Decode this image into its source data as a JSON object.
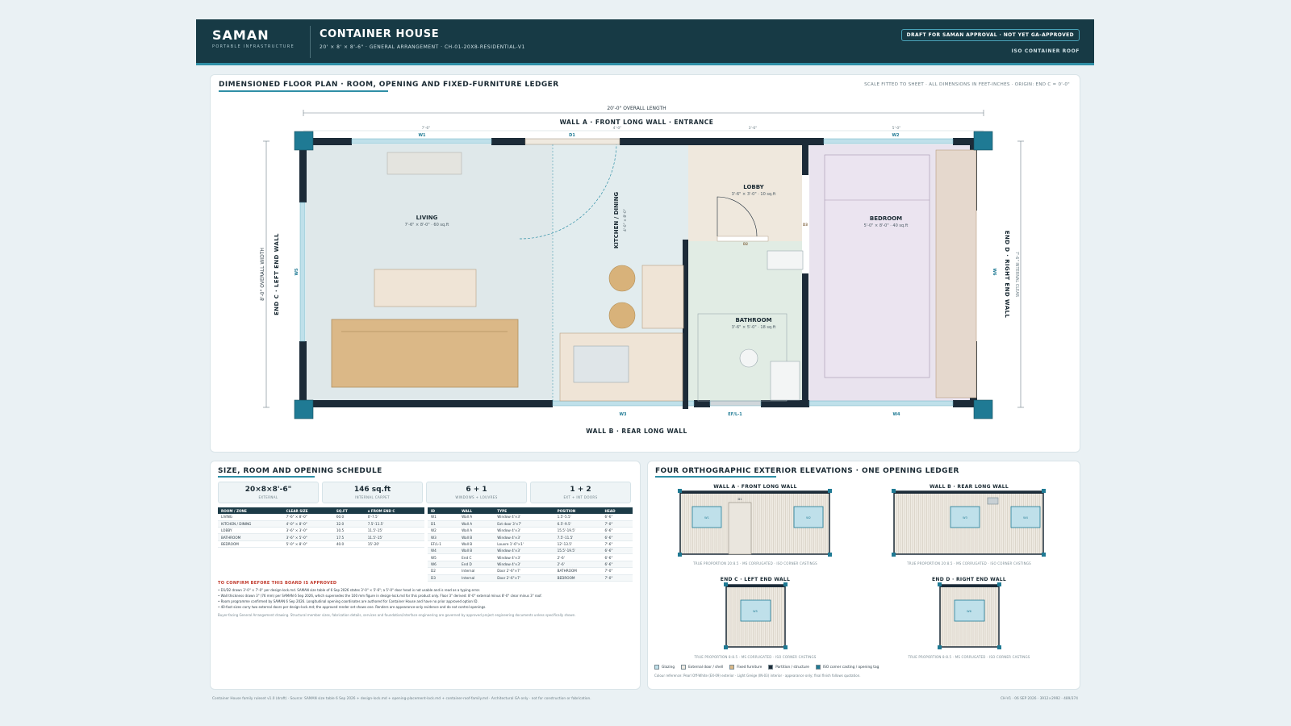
{
  "header": {
    "brand": "SAMAN",
    "brand_sub": "PORTABLE INFRASTRUCTURE",
    "title": "CONTAINER HOUSE",
    "subtitle": "20' × 8' × 8'-6\" · GENERAL ARRANGEMENT · CH-01-20X8-RESIDENTIAL-V1",
    "badge": "DRAFT FOR SAMAN APPROVAL · NOT YET GA-APPROVED",
    "roof": "ISO CONTAINER ROOF"
  },
  "plan": {
    "title": "DIMENSIONED FLOOR PLAN · ROOM, OPENING AND FIXED-FURNITURE LEDGER",
    "scale_note": "SCALE FITTED TO SHEET · ALL DIMENSIONS IN FEET-INCHES · ORIGIN: END C = 0'-0\"",
    "overall_length": "20'-0\" OVERALL LENGTH",
    "overall_width": "8'-0\" OVERALL WIDTH",
    "internal_clear": "7'-6\" INTERNAL CLEAR",
    "wall_a": "WALL A · FRONT LONG WALL · ENTRANCE",
    "wall_b": "WALL B · REAR LONG WALL",
    "wall_c": "END C · LEFT END WALL",
    "wall_d": "END D · RIGHT END WALL",
    "top_dims": [
      "7'-6\"",
      "4'-0\"",
      "3'-6\"",
      "5'-0\""
    ],
    "openings": {
      "w1": "W1",
      "d1": "D1",
      "w2": "W2",
      "w3": "W3",
      "efl1": "EF/L-1",
      "w4": "W4",
      "w5": "W5",
      "w6": "W6",
      "d2": "D2",
      "d3": "D3"
    },
    "rooms": {
      "living": {
        "name": "LIVING",
        "size": "7'-6\" × 8'-0\" · 60 sq.ft"
      },
      "kitchen": {
        "name": "KITCHEN / DINING",
        "size": "4'-0\" × 8'-0\""
      },
      "lobby": {
        "name": "LOBBY",
        "size": "3'-6\" × 3'-0\" · 10 sq.ft"
      },
      "bathroom": {
        "name": "BATHROOM",
        "size": "3'-6\" × 5'-0\" · 18 sq.ft"
      },
      "bedroom": {
        "name": "BEDROOM",
        "size": "5'-0\" × 8'-0\" · 40 sq.ft"
      }
    }
  },
  "schedule": {
    "title": "SIZE, ROOM AND OPENING SCHEDULE",
    "stats": [
      {
        "value": "20×8×8'-6\"",
        "label": "EXTERNAL"
      },
      {
        "value": "146 sq.ft",
        "label": "INTERNAL CARPET"
      },
      {
        "value": "6 + 1",
        "label": "WINDOWS + LOUVRES"
      },
      {
        "value": "1 + 2",
        "label": "EXT + INT DOORS"
      }
    ],
    "room_headers": [
      "ROOM / ZONE",
      "CLEAR SIZE",
      "SQ.FT",
      "x FROM END C"
    ],
    "rooms": [
      [
        "LIVING",
        "7'-6\" × 8'-0\"",
        "60.0",
        "0'-7.5'"
      ],
      [
        "KITCHEN / DINING",
        "4'-0\" × 8'-0\"",
        "32.0",
        "7.5'-11.5'"
      ],
      [
        "LOBBY",
        "3'-6\" × 3'-0\"",
        "10.5",
        "11.5'-15'"
      ],
      [
        "BATHROOM",
        "3'-6\" × 5'-0\"",
        "17.5",
        "11.5'-15'"
      ],
      [
        "BEDROOM",
        "5'-0\" × 8'-0\"",
        "40.0",
        "15'-20'"
      ]
    ],
    "opening_headers": [
      "ID",
      "WALL",
      "TYPE",
      "POSITION",
      "HEAD"
    ],
    "openings": [
      [
        "W1",
        "Wall A",
        "Window 4'×3'",
        "1.5'-5.5'",
        "6'-6\""
      ],
      [
        "D1",
        "Wall A",
        "Ext door 3'×7'",
        "6.5'-9.5'",
        "7'-0\""
      ],
      [
        "W2",
        "Wall A",
        "Window 4'×3'",
        "15.5'-19.5'",
        "6'-6\""
      ],
      [
        "W3",
        "Wall B",
        "Window 4'×3'",
        "7.5'-11.5'",
        "6'-6\""
      ],
      [
        "EF/L-1",
        "Wall B",
        "Louvre 1'-6\"×1'",
        "12'-13.5'",
        "7'-6\""
      ],
      [
        "W4",
        "Wall B",
        "Window 4'×3'",
        "15.5'-19.5'",
        "6'-6\""
      ],
      [
        "W5",
        "End C",
        "Window 4'×3'",
        "2'-6'",
        "6'-6\""
      ],
      [
        "W6",
        "End D",
        "Window 4'×3'",
        "2'-6'",
        "6'-6\""
      ],
      [
        "D2",
        "Internal",
        "Door 2'-6\"×7'",
        "BATHROOM",
        "7'-0\""
      ],
      [
        "D3",
        "Internal",
        "Door 2'-6\"×7'",
        "BEDROOM",
        "7'-0\""
      ]
    ],
    "confirm_title": "TO CONFIRM BEFORE THIS BOARD IS APPROVED",
    "confirm_items": [
      "• D1/D2 drawn 3'-0\" × 7'-0\" per design-lock.md. SAMAN size table of 6 Sep 2026 states 3'-0\" × 5'-6\"; a 5'-0\" door head is not usable and is read as a typing error.",
      "• Wall thickness drawn 3\" (76 mm) per SAMAN 6 Sep 2026, which supersedes the 100 mm figure in design-lock.md for this product only. Floor 3\" derived: 8'-0\" external minus 8'-0\" clear minus 3\" roof.",
      "• Room programme confirmed by SAMAN 6 Sep 2026. Longitudinal opening coordinates are authored for Container House and have no prior approved option ID.",
      "• 40-foot sizes carry two external doors per design-lock.md; the approved render set shows one. Renders are appearance-only evidence and do not control openings."
    ],
    "disclaimer": "Buyer-facing General Arrangement drawing. Structural member sizes, fabrication details, services and foundation/interface engineering are governed by approved project engineering documents unless specifically shown."
  },
  "elevations": {
    "title": "FOUR ORTHOGRAPHIC EXTERIOR ELEVATIONS · ONE OPENING LEDGER",
    "items": [
      {
        "caption": "WALL A · FRONT LONG WALL",
        "foot": "TRUE PROPORTION 20:8.5 · MS CORRUGATED · ISO CORNER CASTINGS"
      },
      {
        "caption": "WALL B · REAR LONG WALL",
        "foot": "TRUE PROPORTION 20:8.5 · MS CORRUGATED · ISO CORNER CASTINGS"
      },
      {
        "caption": "END C · LEFT END WALL",
        "foot": "TRUE PROPORTION 8:8.5 · MS CORRUGATED · ISO CORNER CASTINGS"
      },
      {
        "caption": "END D · RIGHT END WALL",
        "foot": "TRUE PROPORTION 8:8.5 · MS CORRUGATED · ISO CORNER CASTINGS"
      }
    ],
    "labels": {
      "w1": "W1",
      "d1": "D1",
      "w2": "W2",
      "w3": "W3",
      "w4": "W4",
      "w5": "W5",
      "w6": "W6"
    },
    "legend": [
      {
        "label": "Glazing",
        "color": "#bfe0ea"
      },
      {
        "label": "External door / shell",
        "color": "#eeeae2"
      },
      {
        "label": "Fixed furniture",
        "color": "#dcb987"
      },
      {
        "label": "Partition / structure",
        "color": "#1c2b38"
      },
      {
        "label": "ISO corner casting / opening tag",
        "color": "#1f7a94"
      }
    ],
    "color_ref": "Colour reference: Pearl Off-White (EX-09) exterior · Light Greige (IN-03) interior · appearance only; final finish follows quotation."
  },
  "footer": {
    "left": "Container House family ruleset v1.0 (draft) · Source: SAMAN size table 6 Sep 2026 + design-lock.md + opening-placement-lock.md + container-roof-family.md · Architectural GA only · not for construction or fabrication.",
    "right": "CH-V1 · 06 SEP 2026 · 3912×2992 · 489/374"
  },
  "colors": {
    "header_bg": "#173a45",
    "accent": "#2f8fa6",
    "structure": "#1c2b38",
    "glazing": "#bfe0ea"
  }
}
